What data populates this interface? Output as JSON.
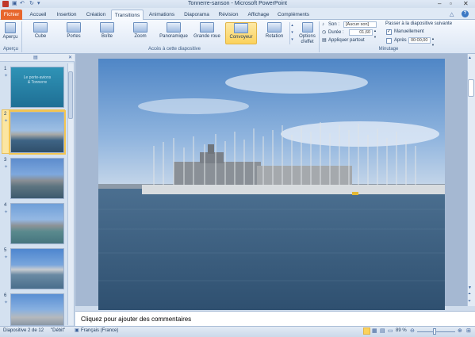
{
  "title_bar": {
    "title": "Tonnerre-sanson - Microsoft PowerPoint"
  },
  "tabs": [
    "Fichier",
    "Accueil",
    "Insertion",
    "Création",
    "Transitions",
    "Animations",
    "Diaporama",
    "Révision",
    "Affichage",
    "Compléments"
  ],
  "ribbon": {
    "apercu_button": "Aperçu",
    "apercu_group": "Aperçu",
    "transitions": [
      "Cube",
      "Portes",
      "Boîte",
      "Zoom",
      "Panoramique",
      "Grande roue",
      "Convoyeur",
      "Rotation"
    ],
    "options": "Options d'effet",
    "acces_group": "Accès à cette diapositive",
    "son_label": "Son :",
    "son_value": "[Aucun son]",
    "duree_label": "Durée :",
    "duree_value": "01,60",
    "appliquer": "Appliquer partout",
    "passer_label": "Passer à la diapositive suivante",
    "manuellement": "Manuellement",
    "apres_label": "Après :",
    "apres_value": "00:00,00",
    "minutage_group": "Minutage"
  },
  "thumbnails": [
    {
      "number": "1",
      "text_line1": "Le porte-avions",
      "text_line2": "& Tonnerre"
    },
    {
      "number": "2"
    },
    {
      "number": "3"
    },
    {
      "number": "4"
    },
    {
      "number": "5"
    },
    {
      "number": "6"
    }
  ],
  "notes_placeholder": "Cliquez pour ajouter des commentaires",
  "status": {
    "slide": "Diapositive 2 de 12",
    "theme": "\"Débit\"",
    "language": "Français (France)",
    "zoom": "89 %"
  },
  "colors": {
    "file_tab": "#e7662c",
    "selected": "#fbd25c",
    "sky": "#5f93cc",
    "sea": "#3e6485"
  }
}
